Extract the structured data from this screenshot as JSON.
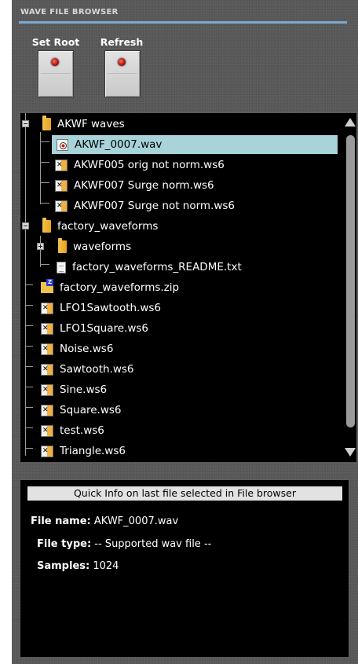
{
  "panel": {
    "title": "WAVE FILE BROWSER",
    "accent_color": "#7aa9d4",
    "buttons": [
      {
        "label": "Set Root",
        "led_color": "#b01810"
      },
      {
        "label": "Refresh",
        "led_color": "#b01810"
      }
    ]
  },
  "tree": {
    "items": [
      {
        "label": "AKWF waves",
        "icon": "folder-icon",
        "expanded": true
      },
      {
        "label": "AKWF_0007.wav",
        "icon": "wav-file-icon",
        "selected": true
      },
      {
        "label": "AKWF005 orig not norm.ws6",
        "icon": "ws6-file-icon"
      },
      {
        "label": "AKWF007 Surge norm.ws6",
        "icon": "ws6-file-icon"
      },
      {
        "label": "AKWF007 Surge not norm.ws6",
        "icon": "ws6-file-icon"
      },
      {
        "label": "factory_waveforms",
        "icon": "folder-icon",
        "expanded": true
      },
      {
        "label": "waveforms",
        "icon": "folder-icon",
        "expanded": false
      },
      {
        "label": "factory_waveforms_README.txt",
        "icon": "text-file-icon"
      },
      {
        "label": "factory_waveforms.zip",
        "icon": "zip-file-icon"
      },
      {
        "label": "LFO1Sawtooth.ws6",
        "icon": "ws6-file-icon"
      },
      {
        "label": "LFO1Square.ws6",
        "icon": "ws6-file-icon"
      },
      {
        "label": "Noise.ws6",
        "icon": "ws6-file-icon"
      },
      {
        "label": "Sawtooth.ws6",
        "icon": "ws6-file-icon"
      },
      {
        "label": "Sine.ws6",
        "icon": "ws6-file-icon"
      },
      {
        "label": "Square.ws6",
        "icon": "ws6-file-icon"
      },
      {
        "label": "test.ws6",
        "icon": "ws6-file-icon"
      },
      {
        "label": "Triangle.ws6",
        "icon": "ws6-file-icon"
      }
    ],
    "selection_color": "#a7d3d9"
  },
  "info": {
    "header": "Quick Info on last file selected in File browser",
    "file_name_label": "File name:",
    "file_name_value": "AKWF_0007.wav",
    "file_type_label": "File type:",
    "file_type_value": "-- Supported wav file --",
    "samples_label": "Samples:",
    "samples_value": "1024"
  }
}
